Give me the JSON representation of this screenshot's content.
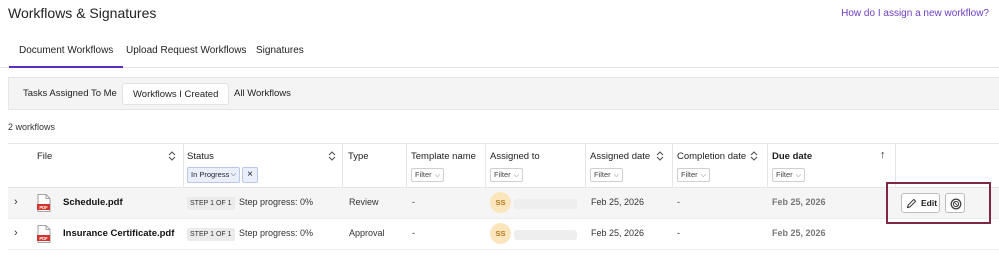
{
  "header": {
    "title": "Workflows & Signatures",
    "help_link": "How do I assign a new workflow?"
  },
  "tabs": [
    {
      "label": "Document Workflows",
      "active": true
    },
    {
      "label": "Upload Request Workflows",
      "active": false
    },
    {
      "label": "Signatures",
      "active": false
    }
  ],
  "subtabs": [
    {
      "label": "Tasks Assigned To Me",
      "active": false
    },
    {
      "label": "Workflows I Created",
      "active": true
    },
    {
      "label": "All Workflows",
      "active": false
    }
  ],
  "count_text": "2 workflows",
  "columns": {
    "file": "File",
    "status": "Status",
    "type": "Type",
    "template_name": "Template name",
    "assigned_to": "Assigned to",
    "assigned_date": "Assigned date",
    "completion_date": "Completion date",
    "due_date": "Due date"
  },
  "filters": {
    "placeholder": "Filter",
    "status_chip": "In Progress",
    "chip_clear": "×"
  },
  "rows": [
    {
      "file": "Schedule.pdf",
      "file_icon": "pdf-icon",
      "step": "STEP 1 OF 1",
      "progress": "Step progress: 0%",
      "type": "Review",
      "template": "-",
      "assignee_initials": "SS",
      "assigned_date": "Feb 25, 2026",
      "completion_date": "-",
      "due_date": "Feb 25, 2026",
      "highlighted": true
    },
    {
      "file": "Insurance Certificate.pdf",
      "file_icon": "pdf-icon",
      "step": "STEP 1 OF 1",
      "progress": "Step progress: 0%",
      "type": "Approval",
      "template": "-",
      "assignee_initials": "SS",
      "assigned_date": "Feb 25, 2026",
      "completion_date": "-",
      "due_date": "Feb 25, 2026",
      "highlighted": false
    }
  ],
  "actions": {
    "edit_label": "Edit",
    "edit_icon": "pencil-icon",
    "cancel_icon": "cancel-circle-icon"
  },
  "icons": {
    "expand": "chevron-right-icon",
    "sort": "sort-icon",
    "sort_asc": "arrow-up-icon",
    "dropdown": "chevron-down-icon"
  },
  "colors": {
    "accent": "#5b2ec2",
    "link": "#6f3fc3",
    "highlight_box": "#7f2846",
    "pdf_red": "#d0342c",
    "avatar_bg": "#fbe5bd"
  }
}
